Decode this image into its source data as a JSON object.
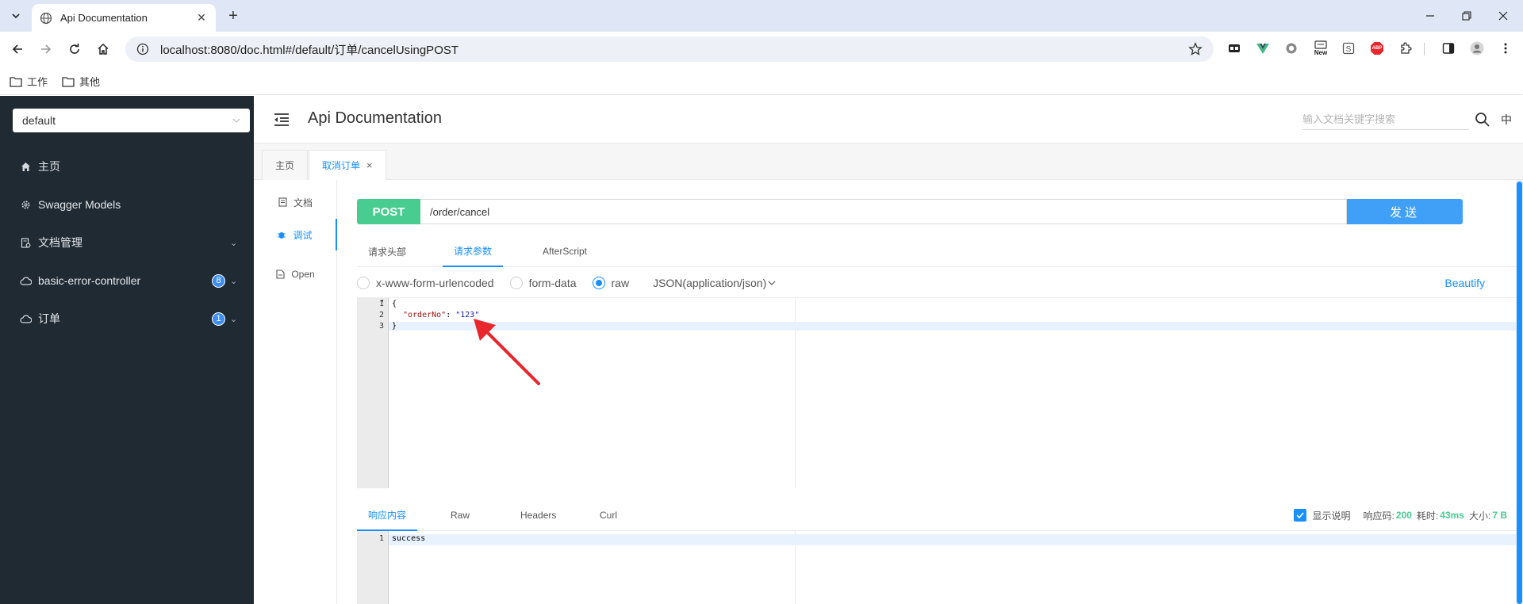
{
  "browser": {
    "tab_title": "Api Documentation",
    "url": "localhost:8080/doc.html#/default/订单/cancelUsingPOST",
    "bookmarks": [
      "工作",
      "其他"
    ],
    "ext_new_label": "New",
    "ext_abp_label": "ABP"
  },
  "sidebar": {
    "group_select": "default",
    "items": [
      {
        "label": "主页",
        "icon": "home-icon"
      },
      {
        "label": "Swagger Models",
        "icon": "gear-icon"
      },
      {
        "label": "文档管理",
        "icon": "document-settings-icon"
      },
      {
        "label": "basic-error-controller",
        "icon": "cloud-icon",
        "badge": "8"
      },
      {
        "label": "订单",
        "icon": "cloud-icon",
        "badge": "1"
      }
    ]
  },
  "header": {
    "title": "Api Documentation",
    "search_placeholder": "输入文档关键字搜索",
    "lang": "中"
  },
  "page_tabs": {
    "home": "主页",
    "current": "取消订单"
  },
  "vtabs": {
    "doc": "文档",
    "debug": "调试",
    "open": "Open"
  },
  "request": {
    "method": "POST",
    "path": "/order/cancel",
    "send": "发送",
    "tabs": [
      "请求头部",
      "请求参数",
      "AfterScript"
    ],
    "content_types": [
      "x-www-form-urlencoded",
      "form-data",
      "raw"
    ],
    "selected_content_type": "raw",
    "json_type": "JSON(application/json)",
    "beautify": "Beautify",
    "body_lines": [
      "{",
      "\"orderNo\"",
      ": ",
      "\"123\"",
      "}"
    ],
    "line_numbers": [
      "1",
      "2",
      "3"
    ]
  },
  "response": {
    "tabs": [
      "响应内容",
      "Raw",
      "Headers",
      "Curl"
    ],
    "show_desc_label": "显示说明",
    "show_desc_checked": true,
    "status_label": "响应码:",
    "status": "200",
    "time_label": "耗时:",
    "time": "43ms",
    "size_label": "大小:",
    "size": "7 B",
    "body": "success",
    "line_numbers": [
      "1"
    ]
  },
  "colors": {
    "sidebar_bg": "#1f2a33",
    "accent": "#1890ff",
    "post_green": "#49cc90",
    "send_blue": "#40a0f8",
    "annotation_arrow": "#e8262c"
  }
}
